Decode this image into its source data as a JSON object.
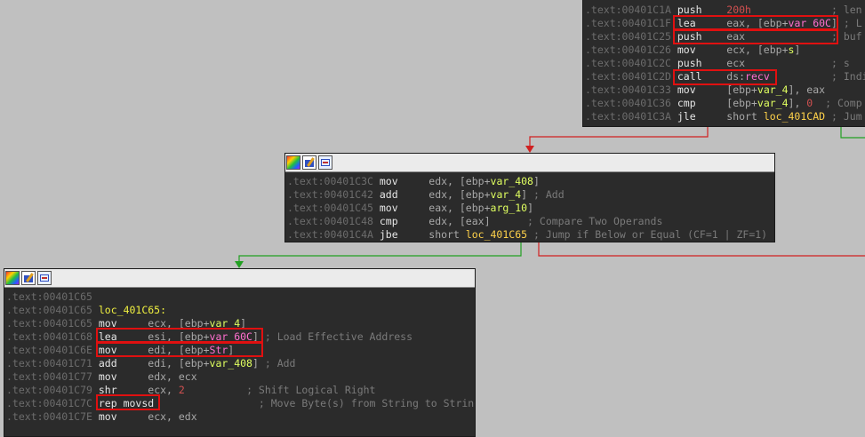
{
  "nodes": {
    "top": {
      "lines": [
        {
          "addr": ".text:00401C1A",
          "parts": [
            [
              "mn",
              "push    "
            ],
            [
              "num",
              "200h"
            ],
            [
              "op",
              "             "
            ],
            [
              "cm",
              "; len"
            ]
          ]
        },
        {
          "addr": ".text:00401C1F",
          "parts": [
            [
              "mn",
              "lea     "
            ],
            [
              "op",
              "eax, [ebp+"
            ],
            [
              "imp",
              "var_60C"
            ],
            [
              "op",
              "]"
            ],
            [
              "cm",
              " ; L"
            ]
          ]
        },
        {
          "addr": ".text:00401C25",
          "parts": [
            [
              "mn",
              "push    "
            ],
            [
              "op",
              "eax              "
            ],
            [
              "cm",
              "; buf"
            ]
          ]
        },
        {
          "addr": ".text:00401C26",
          "parts": [
            [
              "mn",
              "mov     "
            ],
            [
              "op",
              "ecx, [ebp+"
            ],
            [
              "var",
              "s"
            ],
            [
              "op",
              "]"
            ]
          ]
        },
        {
          "addr": ".text:00401C2C",
          "parts": [
            [
              "mn",
              "push    "
            ],
            [
              "op",
              "ecx              "
            ],
            [
              "cm",
              "; s"
            ]
          ]
        },
        {
          "addr": ".text:00401C2D",
          "parts": [
            [
              "mn",
              "call    "
            ],
            [
              "op",
              "ds:"
            ],
            [
              "imp",
              "recv"
            ],
            [
              "op",
              "          "
            ],
            [
              "cm",
              "; Indi"
            ]
          ]
        },
        {
          "addr": ".text:00401C33",
          "parts": [
            [
              "mn",
              "mov     "
            ],
            [
              "op",
              "[ebp+"
            ],
            [
              "var",
              "var_4"
            ],
            [
              "op",
              "], eax"
            ]
          ]
        },
        {
          "addr": ".text:00401C36",
          "parts": [
            [
              "mn",
              "cmp     "
            ],
            [
              "op",
              "[ebp+"
            ],
            [
              "var",
              "var_4"
            ],
            [
              "op",
              "], "
            ],
            [
              "num",
              "0"
            ],
            [
              "op",
              "  "
            ],
            [
              "cm",
              "; Comp"
            ]
          ]
        },
        {
          "addr": ".text:00401C3A",
          "parts": [
            [
              "mn",
              "jle     "
            ],
            [
              "op",
              "short "
            ],
            [
              "loc",
              "loc_401CAD"
            ],
            [
              "op",
              " "
            ],
            [
              "cm",
              "; Jum"
            ]
          ]
        }
      ]
    },
    "middle": {
      "lines": [
        {
          "addr": ".text:00401C3C",
          "parts": [
            [
              "mn",
              "mov     "
            ],
            [
              "op",
              "edx, [ebp+"
            ],
            [
              "var",
              "var_408"
            ],
            [
              "op",
              "]"
            ]
          ]
        },
        {
          "addr": ".text:00401C42",
          "parts": [
            [
              "mn",
              "add     "
            ],
            [
              "op",
              "edx, [ebp+"
            ],
            [
              "var",
              "var_4"
            ],
            [
              "op",
              "] "
            ],
            [
              "cm",
              "; Add"
            ]
          ]
        },
        {
          "addr": ".text:00401C45",
          "parts": [
            [
              "mn",
              "mov     "
            ],
            [
              "op",
              "eax, [ebp+"
            ],
            [
              "var",
              "arg_10"
            ],
            [
              "op",
              "]"
            ]
          ]
        },
        {
          "addr": ".text:00401C48",
          "parts": [
            [
              "mn",
              "cmp     "
            ],
            [
              "op",
              "edx, [eax]      "
            ],
            [
              "cm",
              "; Compare Two Operands"
            ]
          ]
        },
        {
          "addr": ".text:00401C4A",
          "parts": [
            [
              "mn",
              "jbe     "
            ],
            [
              "op",
              "short "
            ],
            [
              "loc",
              "loc_401C65"
            ],
            [
              "op",
              " "
            ],
            [
              "cm",
              "; Jump if Below or Equal (CF=1 | ZF=1)"
            ]
          ]
        }
      ]
    },
    "bottom": {
      "lines": [
        {
          "addr": ".text:00401C65",
          "parts": []
        },
        {
          "addr": ".text:00401C65",
          "parts": [
            [
              "lbl",
              "loc_401C65:"
            ]
          ]
        },
        {
          "addr": ".text:00401C65",
          "parts": [
            [
              "mn",
              "mov     "
            ],
            [
              "op",
              "ecx, [ebp+"
            ],
            [
              "var",
              "var_4"
            ],
            [
              "op",
              "]"
            ]
          ]
        },
        {
          "addr": ".text:00401C68",
          "parts": [
            [
              "mn",
              "lea     "
            ],
            [
              "op",
              "esi, [ebp+"
            ],
            [
              "imp",
              "var_60C"
            ],
            [
              "op",
              "] "
            ],
            [
              "cm",
              "; Load Effective Address"
            ]
          ]
        },
        {
          "addr": ".text:00401C6E",
          "parts": [
            [
              "mn",
              "mov     "
            ],
            [
              "op",
              "edi, [ebp+"
            ],
            [
              "imp",
              "Str"
            ],
            [
              "op",
              "]"
            ]
          ]
        },
        {
          "addr": ".text:00401C71",
          "parts": [
            [
              "mn",
              "add     "
            ],
            [
              "op",
              "edi, [ebp+"
            ],
            [
              "var",
              "var_408"
            ],
            [
              "op",
              "] "
            ],
            [
              "cm",
              "; Add"
            ]
          ]
        },
        {
          "addr": ".text:00401C77",
          "parts": [
            [
              "mn",
              "mov     "
            ],
            [
              "op",
              "edx, ecx"
            ]
          ]
        },
        {
          "addr": ".text:00401C79",
          "parts": [
            [
              "mn",
              "shr     "
            ],
            [
              "op",
              "ecx, "
            ],
            [
              "num",
              "2"
            ],
            [
              "op",
              "          "
            ],
            [
              "cm",
              "; Shift Logical Right"
            ]
          ]
        },
        {
          "addr": ".text:00401C7C",
          "parts": [
            [
              "mn",
              "rep movsd"
            ],
            [
              "op",
              "                 "
            ],
            [
              "cm",
              "; Move Byte(s) from String to String"
            ]
          ]
        },
        {
          "addr": ".text:00401C7E",
          "parts": [
            [
              "mn",
              "mov     "
            ],
            [
              "op",
              "ecx, edx"
            ]
          ]
        }
      ]
    }
  },
  "colors": {
    "background": "#c0c0c0",
    "node_bg": "#2b2b2b",
    "edge_true": "#22a022",
    "edge_false": "#d02020",
    "highlight": "#e01010"
  }
}
